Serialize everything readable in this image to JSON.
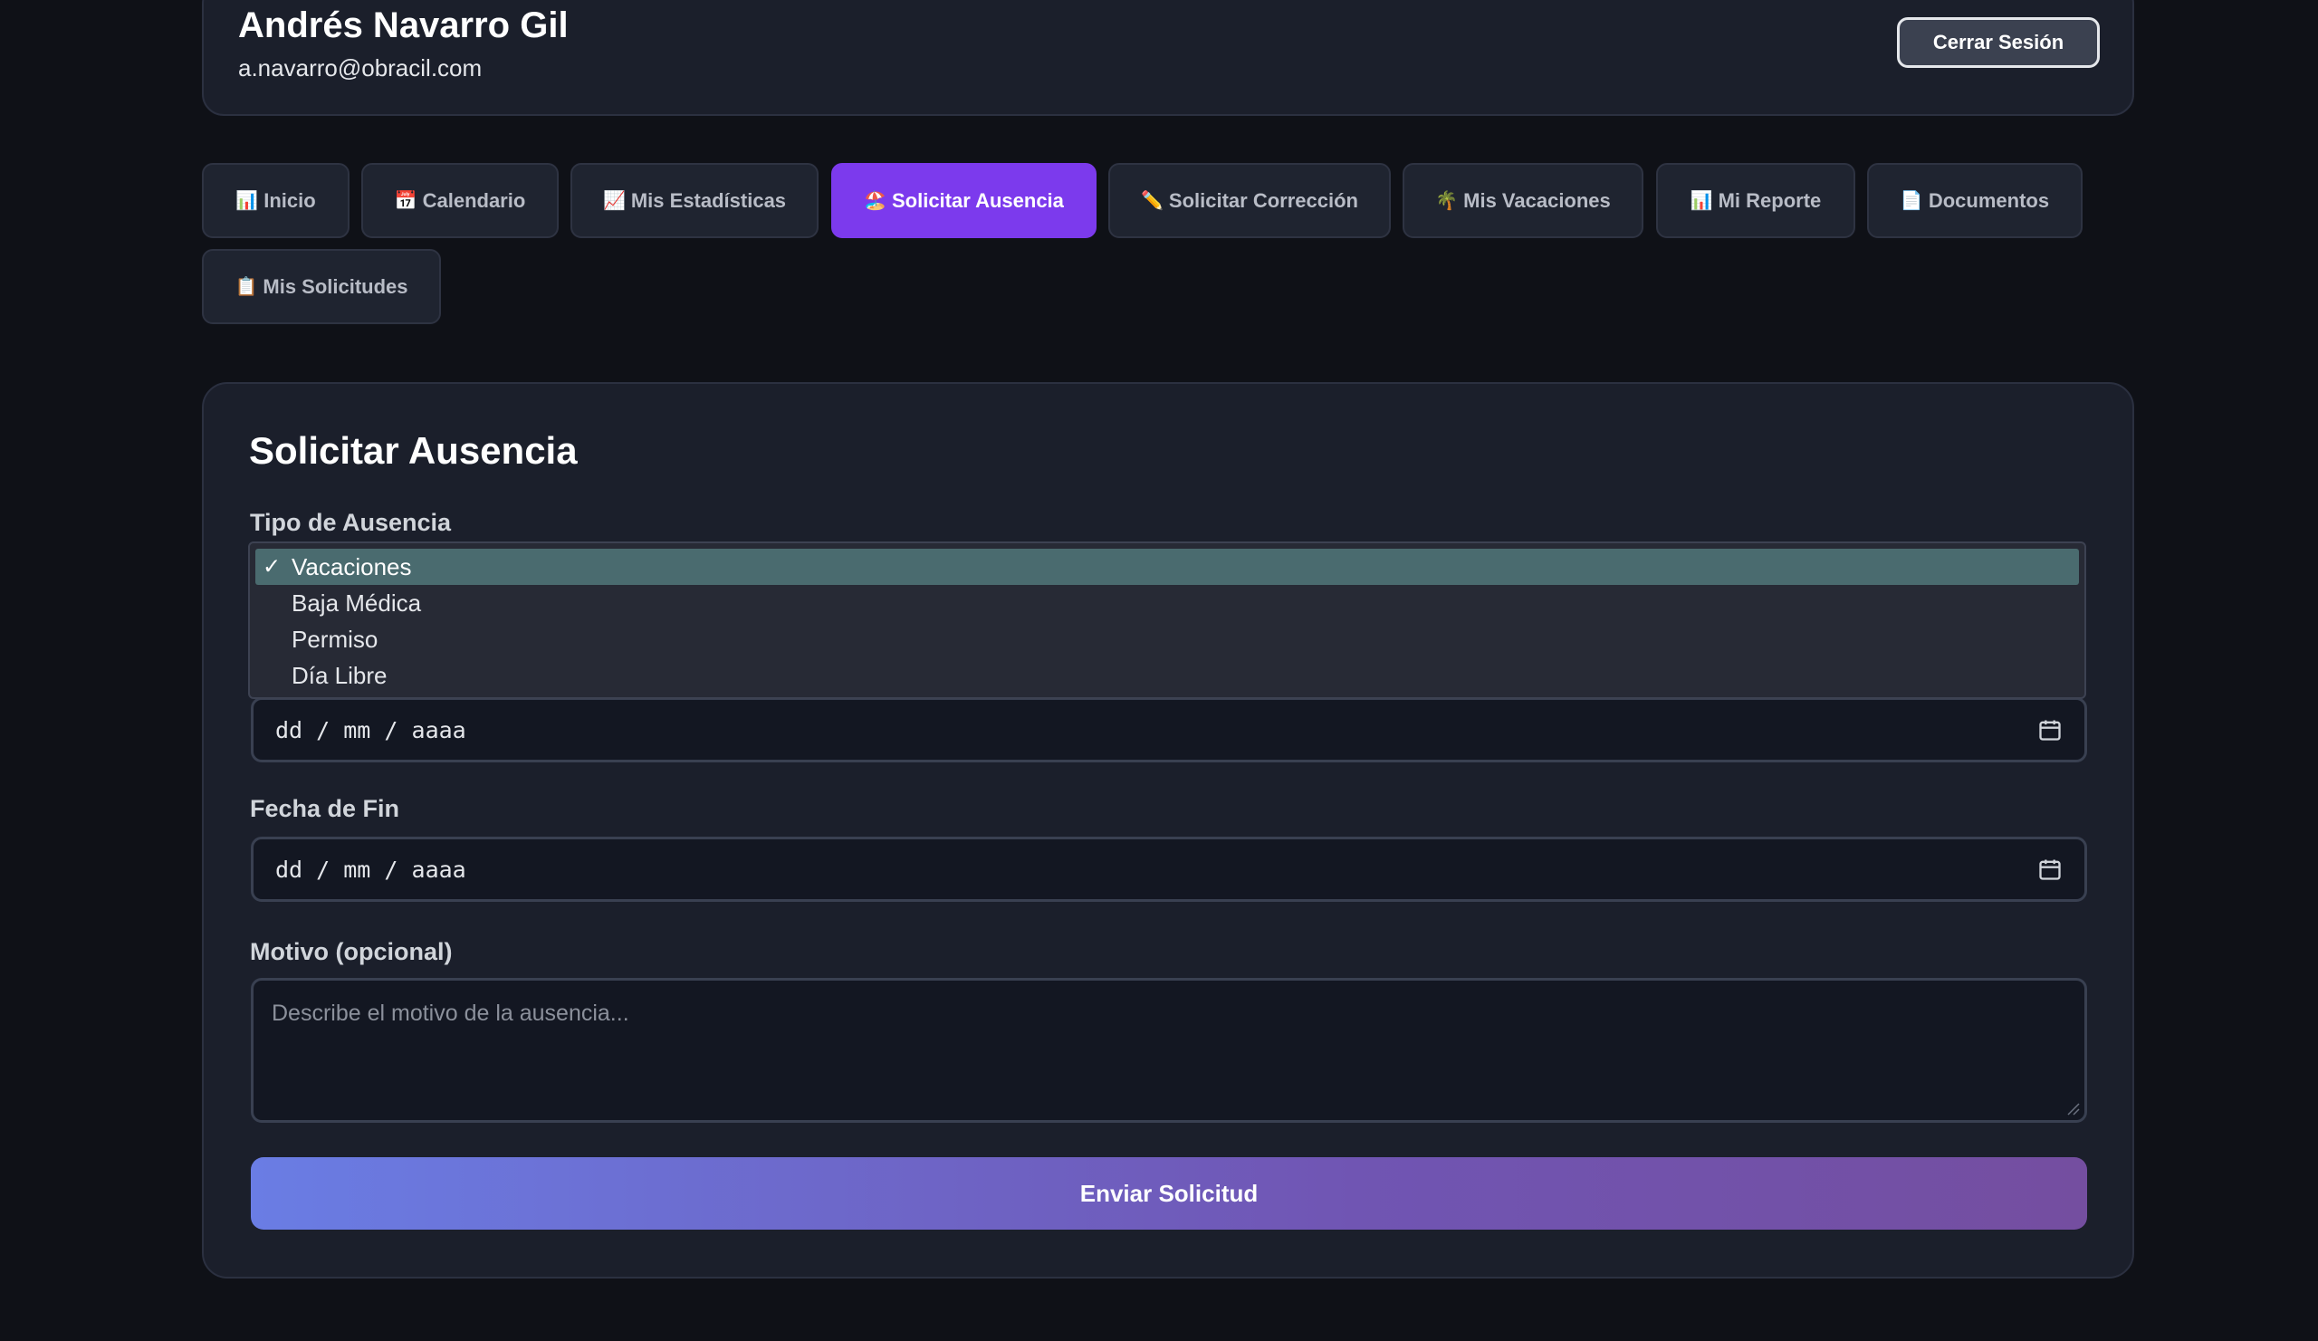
{
  "header": {
    "user_name": "Andrés Navarro Gil",
    "user_email": "a.navarro@obracil.com",
    "logout_label": "Cerrar Sesión"
  },
  "nav": {
    "tabs": [
      {
        "icon": "📊",
        "icon_name": "bar-chart-icon",
        "label": "Inicio",
        "active": false
      },
      {
        "icon": "📅",
        "icon_name": "calendar-icon",
        "label": "Calendario",
        "active": false
      },
      {
        "icon": "📈",
        "icon_name": "trend-chart-icon",
        "label": "Mis Estadísticas",
        "active": false
      },
      {
        "icon": "🏖️",
        "icon_name": "beach-icon",
        "label": "Solicitar Ausencia",
        "active": true
      },
      {
        "icon": "✏️",
        "icon_name": "pencil-icon",
        "label": "Solicitar Corrección",
        "active": false
      },
      {
        "icon": "🌴",
        "icon_name": "palm-tree-icon",
        "label": "Mis Vacaciones",
        "active": false
      },
      {
        "icon": "📊",
        "icon_name": "bar-chart-icon",
        "label": "Mi Reporte",
        "active": false
      },
      {
        "icon": "📄",
        "icon_name": "document-icon",
        "label": "Documentos",
        "active": false
      },
      {
        "icon": "📋",
        "icon_name": "clipboard-icon",
        "label": "Mis Solicitudes",
        "active": false
      }
    ]
  },
  "form": {
    "title": "Solicitar Ausencia",
    "absence_type": {
      "label": "Tipo de Ausencia",
      "selected": "Vacaciones",
      "options": [
        "Vacaciones",
        "Baja Médica",
        "Permiso",
        "Día Libre"
      ]
    },
    "start_date": {
      "placeholder": "dd / mm / aaaa"
    },
    "end_date": {
      "label": "Fecha de Fin",
      "placeholder": "dd / mm / aaaa"
    },
    "reason": {
      "label": "Motivo (opcional)",
      "placeholder": "Describe el motivo de la ausencia..."
    },
    "submit_label": "Enviar Solicitud"
  },
  "colors": {
    "background": "#0f1117",
    "card": "#1b1f2b",
    "accent": "#7c3aed",
    "selected_option": "#4a6b6f",
    "submit_gradient_start": "#6a7de4",
    "submit_gradient_end": "#744ea0"
  }
}
